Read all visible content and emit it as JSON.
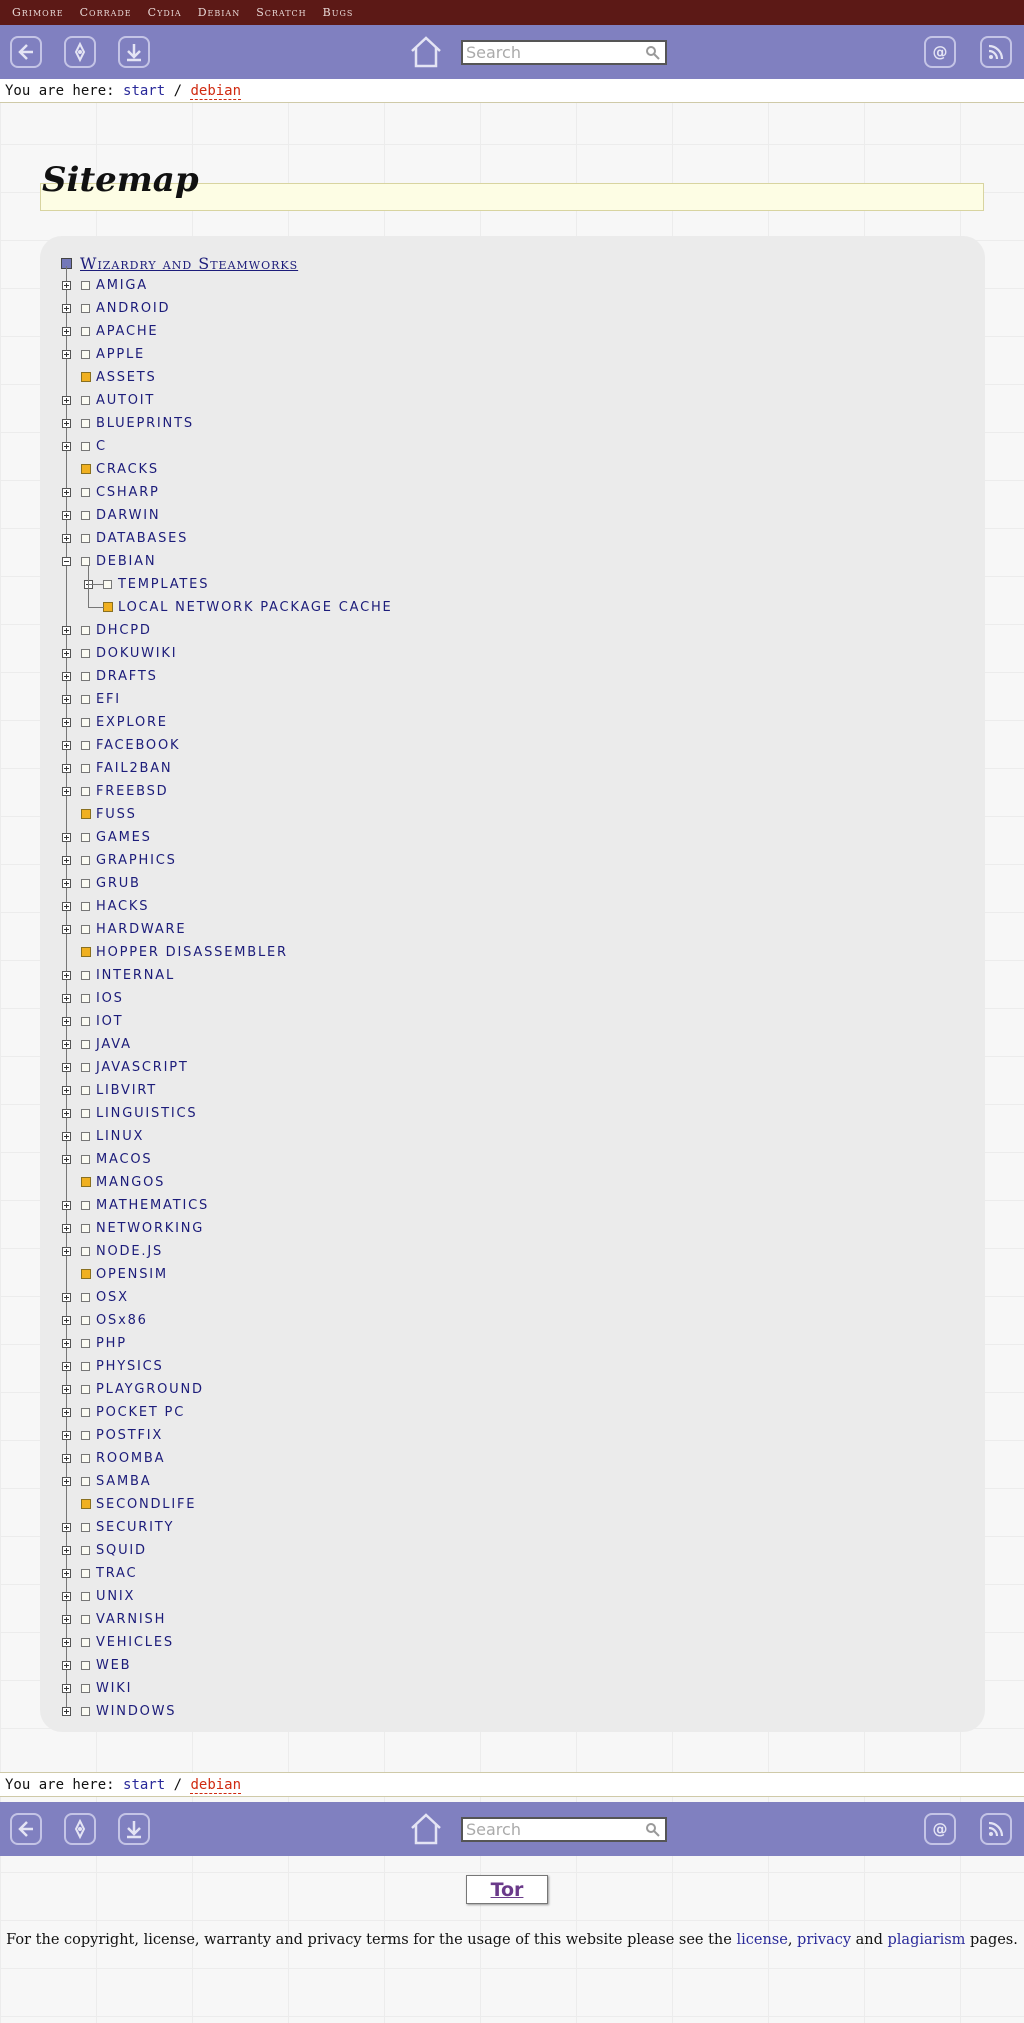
{
  "topnav": {
    "items": [
      "Grimore",
      "Corrade",
      "Cydia",
      "Debian",
      "Scratch",
      "Bugs"
    ]
  },
  "toolbar": {
    "search_placeholder": "Search"
  },
  "breadcrumb": {
    "prefix": "You are here: ",
    "start": "start",
    "sep": " / ",
    "current": "debian"
  },
  "page": {
    "title": "Sitemap"
  },
  "tree": {
    "root": "Wizardry and Steamworks",
    "items": [
      {
        "label": "AMIGA",
        "kind": "ns"
      },
      {
        "label": "ANDROID",
        "kind": "ns"
      },
      {
        "label": "APACHE",
        "kind": "ns"
      },
      {
        "label": "APPLE",
        "kind": "ns"
      },
      {
        "label": "ASSETS",
        "kind": "page"
      },
      {
        "label": "AUTOIT",
        "kind": "ns"
      },
      {
        "label": "BLUEPRINTS",
        "kind": "ns"
      },
      {
        "label": "C",
        "kind": "ns"
      },
      {
        "label": "CRACKS",
        "kind": "page"
      },
      {
        "label": "CSHARP",
        "kind": "ns"
      },
      {
        "label": "DARWIN",
        "kind": "ns"
      },
      {
        "label": "DATABASES",
        "kind": "ns"
      },
      {
        "label": "DEBIAN",
        "kind": "open"
      },
      {
        "label": "TEMPLATES",
        "kind": "child-ns"
      },
      {
        "label": "LOCAL NETWORK PACKAGE CACHE",
        "kind": "child-page"
      },
      {
        "label": "DHCPD",
        "kind": "ns"
      },
      {
        "label": "DOKUWIKI",
        "kind": "ns"
      },
      {
        "label": "DRAFTS",
        "kind": "ns"
      },
      {
        "label": "EFI",
        "kind": "ns"
      },
      {
        "label": "EXPLORE",
        "kind": "ns"
      },
      {
        "label": "FACEBOOK",
        "kind": "ns"
      },
      {
        "label": "FAIL2BAN",
        "kind": "ns"
      },
      {
        "label": "FREEBSD",
        "kind": "ns"
      },
      {
        "label": "FUSS",
        "kind": "page"
      },
      {
        "label": "GAMES",
        "kind": "ns"
      },
      {
        "label": "GRAPHICS",
        "kind": "ns"
      },
      {
        "label": "GRUB",
        "kind": "ns"
      },
      {
        "label": "HACKS",
        "kind": "ns"
      },
      {
        "label": "HARDWARE",
        "kind": "ns"
      },
      {
        "label": "HOPPER DISASSEMBLER",
        "kind": "page"
      },
      {
        "label": "INTERNAL",
        "kind": "ns"
      },
      {
        "label": "IOS",
        "kind": "ns"
      },
      {
        "label": "IOT",
        "kind": "ns"
      },
      {
        "label": "JAVA",
        "kind": "ns"
      },
      {
        "label": "JAVASCRIPT",
        "kind": "ns"
      },
      {
        "label": "LIBVIRT",
        "kind": "ns"
      },
      {
        "label": "LINGUISTICS",
        "kind": "ns"
      },
      {
        "label": "LINUX",
        "kind": "ns"
      },
      {
        "label": "MACOS",
        "kind": "ns"
      },
      {
        "label": "MANGOS",
        "kind": "page"
      },
      {
        "label": "MATHEMATICS",
        "kind": "ns"
      },
      {
        "label": "NETWORKING",
        "kind": "ns"
      },
      {
        "label": "NODE.JS",
        "kind": "ns"
      },
      {
        "label": "OPENSIM",
        "kind": "page"
      },
      {
        "label": "OSX",
        "kind": "ns"
      },
      {
        "label": "OSx86",
        "kind": "ns"
      },
      {
        "label": "PHP",
        "kind": "ns"
      },
      {
        "label": "PHYSICS",
        "kind": "ns"
      },
      {
        "label": "PLAYGROUND",
        "kind": "ns"
      },
      {
        "label": "POCKET PC",
        "kind": "ns"
      },
      {
        "label": "POSTFIX",
        "kind": "ns"
      },
      {
        "label": "ROOMBA",
        "kind": "ns"
      },
      {
        "label": "SAMBA",
        "kind": "ns"
      },
      {
        "label": "SECONDLIFE",
        "kind": "page"
      },
      {
        "label": "SECURITY",
        "kind": "ns"
      },
      {
        "label": "SQUID",
        "kind": "ns"
      },
      {
        "label": "TRAC",
        "kind": "ns"
      },
      {
        "label": "UNIX",
        "kind": "ns"
      },
      {
        "label": "VARNISH",
        "kind": "ns"
      },
      {
        "label": "VEHICLES",
        "kind": "ns"
      },
      {
        "label": "WEB",
        "kind": "ns"
      },
      {
        "label": "WIKI",
        "kind": "ns"
      },
      {
        "label": "WINDOWS",
        "kind": "ns"
      }
    ]
  },
  "footer": {
    "tor_label": "Tor",
    "legal_pre": "For the copyright, license, warranty and privacy terms for the usage of this website please see the ",
    "link_license": "license",
    "sep1": ", ",
    "link_privacy": "privacy",
    "sep2": " and ",
    "link_plagiarism": "plagiarism",
    "legal_post": " pages."
  },
  "colors": {
    "topnav": "#5c1916",
    "toolbar": "#8080c0",
    "link": "#1c1c7a",
    "current": "#d02a10",
    "page_marker": "#f0b020"
  },
  "icons": [
    "back-icon",
    "dokuwiki-icon",
    "download-icon",
    "home-icon",
    "search-icon",
    "email-icon",
    "rss-icon"
  ]
}
